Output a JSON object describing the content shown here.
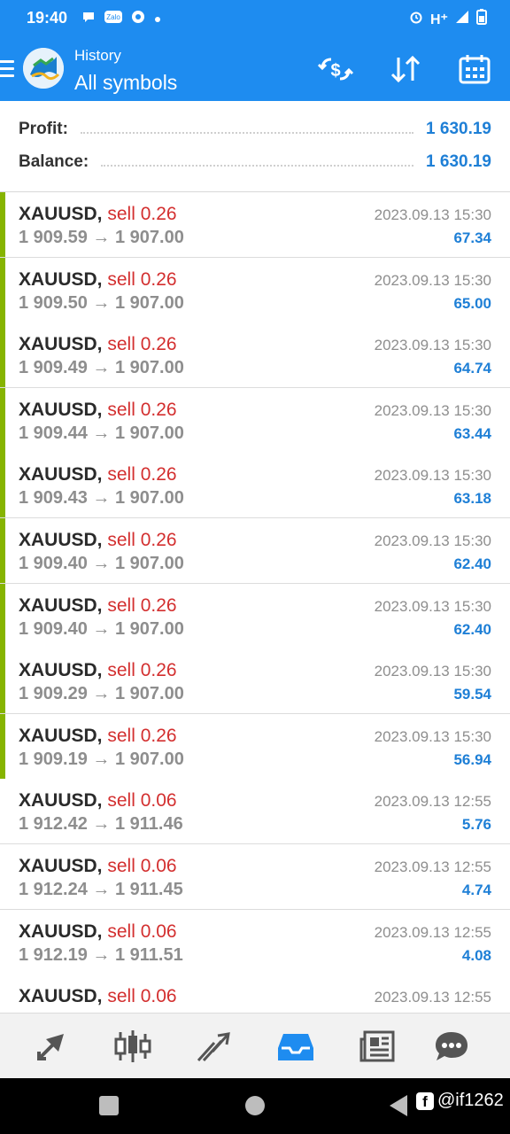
{
  "status_bar": {
    "time": "19:40",
    "network": "H⁺"
  },
  "header": {
    "subtitle": "History",
    "title": "All symbols"
  },
  "summary": {
    "profit_label": "Profit:",
    "profit_value": "1 630.19",
    "balance_label": "Balance:",
    "balance_value": "1 630.19"
  },
  "deals": [
    {
      "symbol": "XAUUSD,",
      "side": "sell 0.26",
      "prices": "1 909.59 → 1 907.00",
      "time": "2023.09.13 15:30",
      "profit": "67.34",
      "highlight": true
    },
    {
      "symbol": "XAUUSD,",
      "side": "sell 0.26",
      "prices": "1 909.50 → 1 907.00",
      "time": "2023.09.13 15:30",
      "profit": "65.00",
      "highlight": true
    },
    {
      "symbol": "XAUUSD,",
      "side": "sell 0.26",
      "prices": "1 909.49 → 1 907.00",
      "time": "2023.09.13 15:30",
      "profit": "64.74",
      "highlight": true
    },
    {
      "symbol": "XAUUSD,",
      "side": "sell 0.26",
      "prices": "1 909.44 → 1 907.00",
      "time": "2023.09.13 15:30",
      "profit": "63.44",
      "highlight": true
    },
    {
      "symbol": "XAUUSD,",
      "side": "sell 0.26",
      "prices": "1 909.43 → 1 907.00",
      "time": "2023.09.13 15:30",
      "profit": "63.18",
      "highlight": true
    },
    {
      "symbol": "XAUUSD,",
      "side": "sell 0.26",
      "prices": "1 909.40 → 1 907.00",
      "time": "2023.09.13 15:30",
      "profit": "62.40",
      "highlight": true
    },
    {
      "symbol": "XAUUSD,",
      "side": "sell 0.26",
      "prices": "1 909.40 → 1 907.00",
      "time": "2023.09.13 15:30",
      "profit": "62.40",
      "highlight": true
    },
    {
      "symbol": "XAUUSD,",
      "side": "sell 0.26",
      "prices": "1 909.29 → 1 907.00",
      "time": "2023.09.13 15:30",
      "profit": "59.54",
      "highlight": true
    },
    {
      "symbol": "XAUUSD,",
      "side": "sell 0.26",
      "prices": "1 909.19 → 1 907.00",
      "time": "2023.09.13 15:30",
      "profit": "56.94",
      "highlight": true
    },
    {
      "symbol": "XAUUSD,",
      "side": "sell 0.06",
      "prices": "1 912.42 → 1 911.46",
      "time": "2023.09.13 12:55",
      "profit": "5.76",
      "highlight": false
    },
    {
      "symbol": "XAUUSD,",
      "side": "sell 0.06",
      "prices": "1 912.24 → 1 911.45",
      "time": "2023.09.13 12:55",
      "profit": "4.74",
      "highlight": false
    },
    {
      "symbol": "XAUUSD,",
      "side": "sell 0.06",
      "prices": "1 912.19 → 1 911.51",
      "time": "2023.09.13 12:55",
      "profit": "4.08",
      "highlight": false
    },
    {
      "symbol": "XAUUSD,",
      "side": "sell 0.06",
      "prices": "",
      "time": "2023.09.13 12:55",
      "profit": "",
      "highlight": false
    }
  ],
  "bottom_tabs": [
    {
      "name": "tab-quotes",
      "icon": "arrows-icon",
      "active": false
    },
    {
      "name": "tab-chart",
      "icon": "candlestick-icon",
      "active": false
    },
    {
      "name": "tab-trade",
      "icon": "trend-icon",
      "active": false
    },
    {
      "name": "tab-history",
      "icon": "inbox-icon",
      "active": true
    },
    {
      "name": "tab-news",
      "icon": "newspaper-icon",
      "active": false
    },
    {
      "name": "tab-messages",
      "icon": "chat-icon",
      "active": false
    }
  ],
  "watermark": "@if1262",
  "colors": {
    "accent": "#1e8cf0",
    "sell": "#d32f2f",
    "profit": "#1e7fd6",
    "highlight_bar": "#86b400"
  }
}
